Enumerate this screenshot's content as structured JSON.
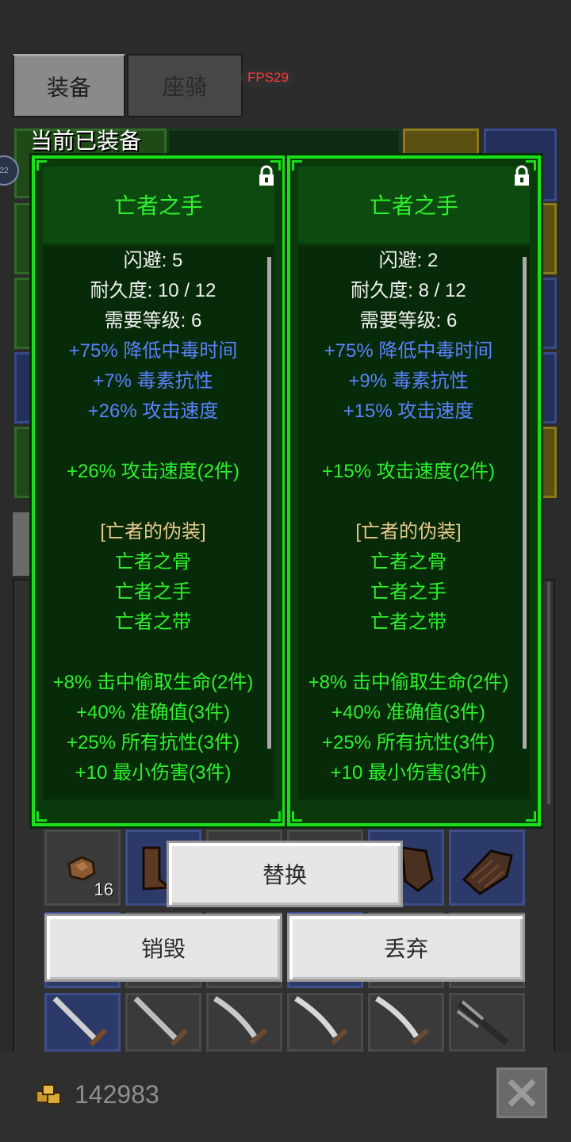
{
  "tabs": [
    {
      "label": "装备",
      "active": true
    },
    {
      "label": "座骑",
      "active": false
    }
  ],
  "fps": "FPS29",
  "section_title": "当前已装备",
  "level_badge": "22",
  "cards": [
    {
      "name": "亡者之手",
      "lines": [
        {
          "text": "闪避: 5",
          "color": "white"
        },
        {
          "text": "耐久度: 10 / 12",
          "color": "white"
        },
        {
          "text": "需要等级: 6",
          "color": "white"
        },
        {
          "text": "+75% 降低中毒时间",
          "color": "blue"
        },
        {
          "text": "+7% 毒素抗性",
          "color": "blue"
        },
        {
          "text": "+26% 攻击速度",
          "color": "blue"
        },
        {
          "text": "",
          "color": "blank"
        },
        {
          "text": "+26% 攻击速度(2件)",
          "color": "green"
        },
        {
          "text": "",
          "color": "blank"
        },
        {
          "text": "[亡者的伪装]",
          "color": "tan"
        },
        {
          "text": "亡者之骨",
          "color": "green"
        },
        {
          "text": "亡者之手",
          "color": "green"
        },
        {
          "text": "亡者之带",
          "color": "green"
        },
        {
          "text": "",
          "color": "blank"
        },
        {
          "text": "+8% 击中偷取生命(2件)",
          "color": "green"
        },
        {
          "text": "+40% 准确值(3件)",
          "color": "green"
        },
        {
          "text": "+25% 所有抗性(3件)",
          "color": "green"
        },
        {
          "text": "+10 最小伤害(3件)",
          "color": "green"
        }
      ]
    },
    {
      "name": "亡者之手",
      "lines": [
        {
          "text": "闪避: 2",
          "color": "white"
        },
        {
          "text": "耐久度: 8 / 12",
          "color": "white"
        },
        {
          "text": "需要等级: 6",
          "color": "white"
        },
        {
          "text": "+75% 降低中毒时间",
          "color": "blue"
        },
        {
          "text": "+9% 毒素抗性",
          "color": "blue"
        },
        {
          "text": "+15% 攻击速度",
          "color": "blue"
        },
        {
          "text": "",
          "color": "blank"
        },
        {
          "text": "+15% 攻击速度(2件)",
          "color": "green"
        },
        {
          "text": "",
          "color": "blank"
        },
        {
          "text": "[亡者的伪装]",
          "color": "tan"
        },
        {
          "text": "亡者之骨",
          "color": "green"
        },
        {
          "text": "亡者之手",
          "color": "green"
        },
        {
          "text": "亡者之带",
          "color": "green"
        },
        {
          "text": "",
          "color": "blank"
        },
        {
          "text": "+8% 击中偷取生命(2件)",
          "color": "green"
        },
        {
          "text": "+40% 准确值(3件)",
          "color": "green"
        },
        {
          "text": "+25% 所有抗性(3件)",
          "color": "green"
        },
        {
          "text": "+10 最小伤害(3件)",
          "color": "green"
        }
      ]
    }
  ],
  "buttons": {
    "replace": "替换",
    "destroy": "销毁",
    "discard": "丢弃"
  },
  "inventory": {
    "stack_count": "16"
  },
  "currency": {
    "gold": "142983"
  },
  "colors": {
    "card_border": "#19e019",
    "stat_blue": "#5a82ff",
    "set_green": "#2ef02e",
    "set_title": "#e8c88c"
  }
}
